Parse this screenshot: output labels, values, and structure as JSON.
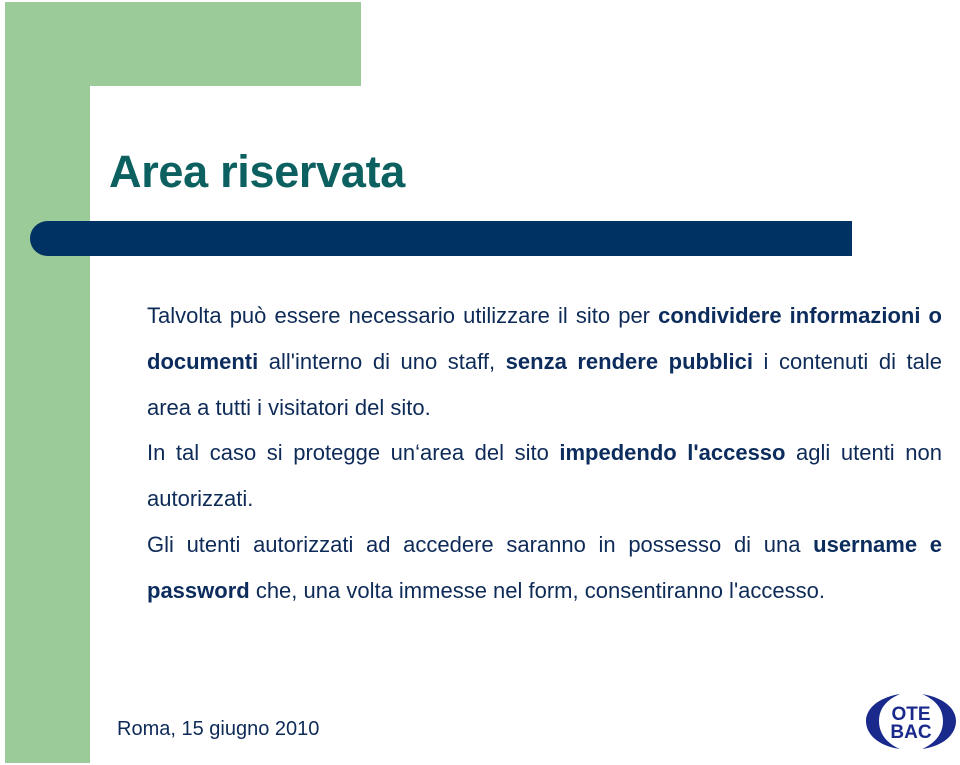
{
  "slide": {
    "title": "Area riservata",
    "paragraphs": [
      [
        {
          "text": "Talvolta può essere necessario utilizzare il sito per ",
          "bold": false
        },
        {
          "text": "condividere informazioni o documenti",
          "bold": true
        },
        {
          "text": " all'interno di uno staff, ",
          "bold": false
        },
        {
          "text": "senza rendere pubblici",
          "bold": true
        },
        {
          "text": " i contenuti di tale area a tutti i visitatori del sito.",
          "bold": false
        }
      ],
      [
        {
          "text": "In tal caso si protegge un‘area del sito ",
          "bold": false
        },
        {
          "text": "impedendo l'accesso",
          "bold": true
        },
        {
          "text": " agli utenti non autorizzati.",
          "bold": false
        }
      ],
      [
        {
          "text": "Gli utenti autorizzati ad accedere saranno in possesso di una ",
          "bold": false
        },
        {
          "text": "username e password",
          "bold": true
        },
        {
          "text": " che, una volta immesse nel form, consentiranno l'accesso.",
          "bold": false
        }
      ]
    ]
  },
  "footer": {
    "date": "Roma, 15 giugno 2010"
  },
  "logo": {
    "line1": "OTE",
    "line2": "BAC",
    "color": "#1a2a8c"
  },
  "colors": {
    "green": "#9bcb98",
    "navy_bar": "#003263",
    "title": "#0c6060",
    "body": "#0e2b58"
  }
}
